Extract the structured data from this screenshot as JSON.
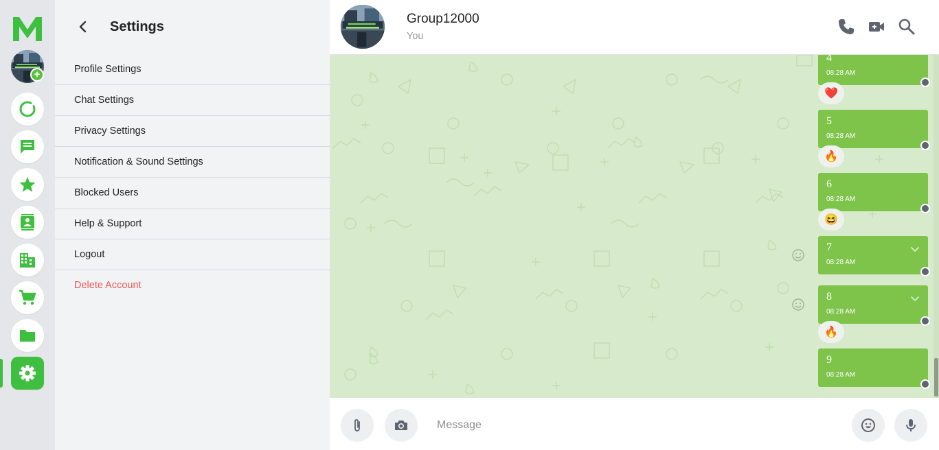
{
  "app": {
    "logo_letter": "M",
    "accent_color": "#3fbf3f",
    "bubble_color": "#7ec34a",
    "chat_bg_color": "#d7ebcc"
  },
  "rail": {
    "items": [
      {
        "name": "status",
        "icon": "status-ring-icon"
      },
      {
        "name": "chats",
        "icon": "chat-bubble-icon"
      },
      {
        "name": "starred",
        "icon": "star-icon"
      },
      {
        "name": "contacts",
        "icon": "contact-card-icon"
      },
      {
        "name": "business",
        "icon": "building-icon"
      },
      {
        "name": "shop",
        "icon": "cart-icon"
      },
      {
        "name": "files",
        "icon": "folder-icon"
      },
      {
        "name": "settings",
        "icon": "gear-icon",
        "active": true
      }
    ]
  },
  "settings": {
    "title": "Settings",
    "menu": [
      {
        "label": "Profile Settings"
      },
      {
        "label": "Chat Settings"
      },
      {
        "label": "Privacy Settings"
      },
      {
        "label": "Notification & Sound Settings"
      },
      {
        "label": "Blocked Users"
      },
      {
        "label": "Help & Support"
      },
      {
        "label": "Logout"
      },
      {
        "label": "Delete Account",
        "danger": true
      }
    ]
  },
  "chat": {
    "name": "Group12000",
    "subtitle": "You",
    "header_icons": [
      "phone-icon",
      "video-call-icon",
      "search-icon"
    ],
    "messages": [
      {
        "text": "4",
        "time": "08:28 AM",
        "reaction": "❤️"
      },
      {
        "text": "5",
        "time": "08:28 AM",
        "reaction": "🔥"
      },
      {
        "text": "6",
        "time": "08:28 AM",
        "reaction": "😆"
      },
      {
        "text": "7",
        "time": "08:28 AM"
      },
      {
        "text": "8",
        "time": "08:28 AM",
        "reaction": "🔥"
      },
      {
        "text": "9",
        "time": "08:28 AM"
      }
    ]
  },
  "composer": {
    "placeholder": "Message",
    "icons": [
      "attachment-icon",
      "camera-icon",
      "emoji-icon",
      "microphone-icon"
    ]
  }
}
